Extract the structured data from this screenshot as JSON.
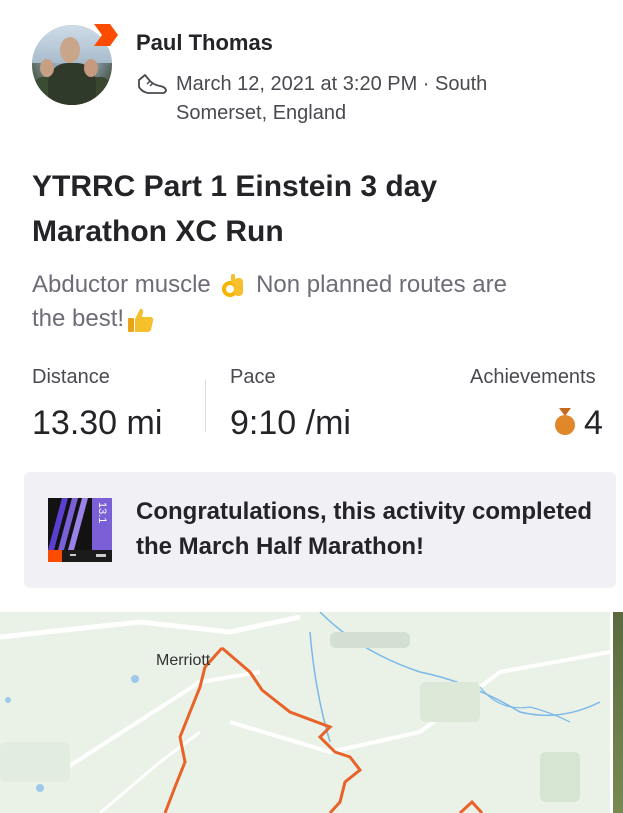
{
  "athlete": {
    "name": "Paul Thomas"
  },
  "activity_meta": {
    "line1": "March 12, 2021 at 3:20 PM · South",
    "line2": "Somerset, England",
    "activity_icon": "shoe-icon"
  },
  "activity": {
    "title_line1": "YTRRC Part 1 Einstein 3 day",
    "title_line2": "Marathon XC Run",
    "description_part1": "Abductor muscle",
    "description_part2": "Non planned routes are",
    "description_part3": "the best!"
  },
  "stats": {
    "distance_label": "Distance",
    "distance_value": "13.30 mi",
    "pace_label": "Pace",
    "pace_value": "9:10 /mi",
    "achievements_label": "Achievements",
    "achievements_value": "4"
  },
  "achievement_card": {
    "text": "Congratulations, this activity completed the March Half Marathon!",
    "badge_label": "13.1"
  },
  "map": {
    "place_label": "Merriott"
  },
  "colors": {
    "brand_orange": "#fc4c02",
    "route_orange": "#e8632a",
    "medal_bronze": "#e0872a",
    "badge_purple": "#7b5fd6"
  }
}
